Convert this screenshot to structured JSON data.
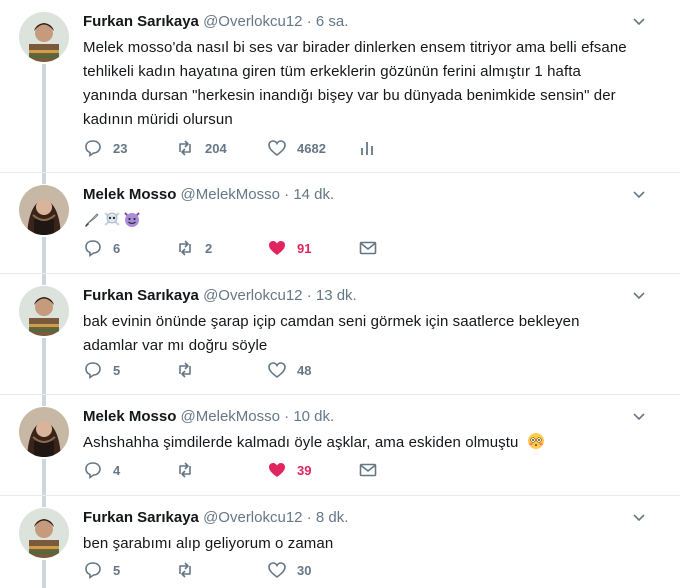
{
  "tweets": [
    {
      "name": "Furkan Sarıkaya",
      "handle": "@Overlokcu12",
      "dot": "·",
      "time": "6 sa.",
      "text_lines": [
        "Melek mosso'da nasıl bi ses var birader dinlerken ensem titriyor ama belli efsane",
        "tehlikeli kadın hayatına giren tüm erkeklerin gözünün ferini almıştır 1 hafta",
        "yanında dursan \"herkesin inandığı bişey var bu dünyada benimkide sensin\" der",
        "kadının müridi olursun"
      ],
      "replies": "23",
      "retweets": "204",
      "likes": "4682",
      "liked": false,
      "has_dm": false,
      "has_analytics": true
    },
    {
      "name": "Melek Mosso",
      "handle": "@MelekMosso",
      "dot": "·",
      "time": "14 dk.",
      "emojis": [
        "knife-emoji",
        "skull-crossbones-emoji",
        "smiling-imp-emoji"
      ],
      "replies": "6",
      "retweets": "2",
      "likes": "91",
      "liked": true,
      "has_dm": true,
      "has_analytics": false
    },
    {
      "name": "Furkan Sarıkaya",
      "handle": "@Overlokcu12",
      "dot": "·",
      "time": "13 dk.",
      "text_lines": [
        "bak evinin önünde şarap içip camdan seni görmek için saatlerce bekleyen",
        "adamlar var mı doğru söyle"
      ],
      "replies": "5",
      "retweets": "",
      "likes": "48",
      "liked": false,
      "has_dm": false,
      "has_analytics": false
    },
    {
      "name": "Melek Mosso",
      "handle": "@MelekMosso",
      "dot": "·",
      "time": "10 dk.",
      "text_lines": [
        "Ashshahha şimdilerde kalmadı öyle aşklar, ama eskiden olmuştu"
      ],
      "trailing_emoji": "flushed-face-emoji",
      "replies": "4",
      "retweets": "",
      "likes": "39",
      "liked": true,
      "has_dm": true,
      "has_analytics": false
    },
    {
      "name": "Furkan Sarıkaya",
      "handle": "@Overlokcu12",
      "dot": "·",
      "time": "8 dk.",
      "text_lines": [
        "ben şarabımı alıp geliyorum o zaman"
      ],
      "replies": "5",
      "retweets": "",
      "likes": "30",
      "liked": false,
      "has_dm": false,
      "has_analytics": false
    }
  ],
  "colors": {
    "text": "#14171a",
    "secondary": "#657786",
    "like": "#e0245e",
    "thread_line": "#ccd6dd",
    "divider": "#e6ecf0"
  }
}
